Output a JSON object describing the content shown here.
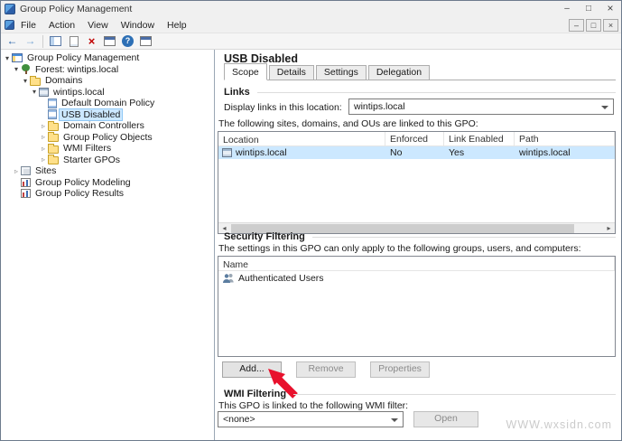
{
  "window": {
    "title": "Group Policy Management",
    "menu": [
      "File",
      "Action",
      "View",
      "Window",
      "Help"
    ]
  },
  "tree": {
    "items": [
      {
        "label": "Group Policy Management"
      },
      {
        "label": "Forest: wintips.local"
      },
      {
        "label": "Domains"
      },
      {
        "label": "wintips.local"
      },
      {
        "label": "Default Domain Policy"
      },
      {
        "label": "USB Disabled"
      },
      {
        "label": "Domain Controllers"
      },
      {
        "label": "Group Policy Objects"
      },
      {
        "label": "WMI Filters"
      },
      {
        "label": "Starter GPOs"
      },
      {
        "label": "Sites"
      },
      {
        "label": "Group Policy Modeling"
      },
      {
        "label": "Group Policy Results"
      }
    ]
  },
  "gpo": {
    "title": "USB Disabled",
    "tabs": [
      "Scope",
      "Details",
      "Settings",
      "Delegation"
    ],
    "links": {
      "heading": "Links",
      "display_label": "Display links in this location:",
      "display_value": "wintips.local",
      "caption": "The following sites, domains, and OUs are linked to this GPO:",
      "columns": [
        "Location",
        "Enforced",
        "Link Enabled",
        "Path"
      ],
      "rows": [
        {
          "location": "wintips.local",
          "enforced": "No",
          "link_enabled": "Yes",
          "path": "wintips.local"
        }
      ]
    },
    "security": {
      "heading": "Security Filtering",
      "caption": "The settings in this GPO can only apply to the following groups, users, and computers:",
      "name_column": "Name",
      "rows": [
        {
          "name": "Authenticated Users"
        }
      ],
      "add_label": "Add...",
      "remove_label": "Remove",
      "properties_label": "Properties"
    },
    "wmi": {
      "heading": "WMI Filtering",
      "caption": "This GPO is linked to the following WMI filter:",
      "value": "<none>",
      "open_label": "Open"
    }
  },
  "watermark": "WWW.wxsidn.com"
}
